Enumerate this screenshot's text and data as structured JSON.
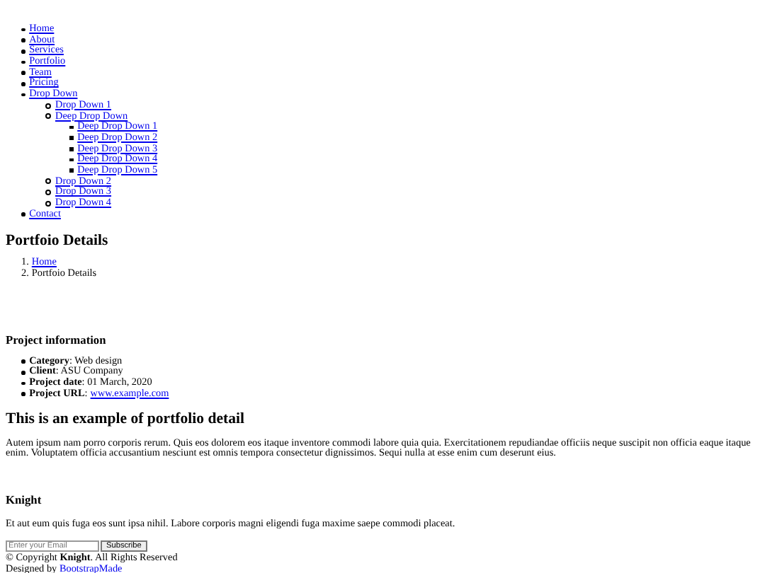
{
  "nav": [
    {
      "label": "Home"
    },
    {
      "label": "About"
    },
    {
      "label": "Services"
    },
    {
      "label": "Portfolio"
    },
    {
      "label": "Team"
    },
    {
      "label": "Pricing"
    },
    {
      "label": "Drop Down",
      "children": [
        {
          "label": "Drop Down 1"
        },
        {
          "label": "Deep Drop Down",
          "children": [
            {
              "label": "Deep Drop Down 1"
            },
            {
              "label": "Deep Drop Down 2"
            },
            {
              "label": "Deep Drop Down 3"
            },
            {
              "label": "Deep Drop Down 4"
            },
            {
              "label": "Deep Drop Down 5"
            }
          ]
        },
        {
          "label": "Drop Down 2"
        },
        {
          "label": "Drop Down 3"
        },
        {
          "label": "Drop Down 4"
        }
      ]
    },
    {
      "label": "Contact"
    }
  ],
  "page_title": "Portfoio Details",
  "breadcrumb": [
    {
      "number": "1.",
      "label": "Home",
      "kind": "link"
    },
    {
      "number": "2.",
      "label": "Portfoio Details",
      "kind": "text"
    }
  ],
  "project_info": {
    "title": "Project information",
    "items": [
      {
        "text": "**Category**: Web design"
      },
      {
        "text": "**Client**: ASU Company"
      },
      {
        "text": "**Project date**: 01 March, 2020"
      },
      {
        "text": "**Project URL**:",
        "link": "www.example.com"
      }
    ]
  },
  "detail": {
    "title": "This is an example of portfolio detail",
    "body": "Autem ipsum nam porro corporis rerum. Quis eos dolorem eos itaque inventore commodi labore quia quia. Exercitationem repudiandae officiis neque suscipit non officia eaque itaque enim. Voluptatem officia accusantium nesciunt est omnis tempora consectetur dignissimos. Sequi nulla at esse enim cum deserunt eius."
  },
  "footer": {
    "title": "Knight",
    "text": "Et aut eum quis fuga eos sunt ipsa nihil. Labore corporis magni eligendi fuga maxime saepe commodi placeat.",
    "email_placeholder": "Enter your Email",
    "subscribe": "Subscribe",
    "copyright": "© Copyright **Knight**. All Rights Reserved",
    "designed_by": "Designed by",
    "designer_link": "BootstrapMade"
  }
}
